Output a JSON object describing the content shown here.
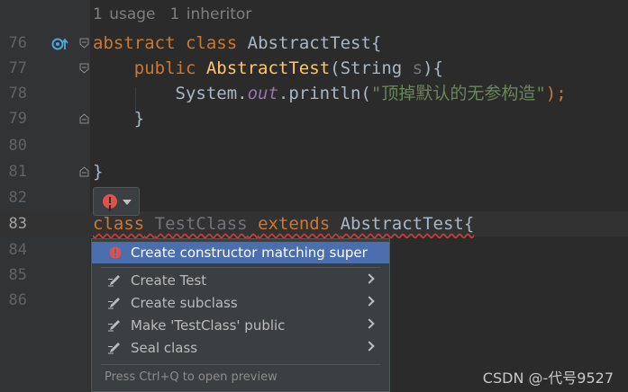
{
  "editor": {
    "hints": {
      "usages": "1 usage",
      "inheritors": "1 inheritor"
    },
    "lines": [
      {
        "number": "76",
        "tokens": [
          "abstract",
          "class",
          "AbstractTest{"
        ]
      },
      {
        "number": "77",
        "tokens": [
          "public",
          "AbstractTest",
          "(String ",
          "s",
          "){"
        ]
      },
      {
        "number": "78",
        "tokens": [
          "System.",
          "out",
          ".println(",
          "\"顶掉默认的无参构造\"",
          ");"
        ]
      },
      {
        "number": "79",
        "tokens": [
          "}"
        ]
      },
      {
        "number": "80",
        "tokens": []
      },
      {
        "number": "81",
        "tokens": [
          "}"
        ]
      },
      {
        "number": "82",
        "tokens": []
      },
      {
        "number": "83",
        "tokens": [
          "class",
          "TestClass",
          "extends",
          "AbstractTest{"
        ]
      },
      {
        "number": "84",
        "tokens": []
      },
      {
        "number": "85",
        "tokens": []
      },
      {
        "number": "86",
        "tokens": []
      }
    ],
    "current_line": "83",
    "gutter_icons": {
      "line_76": "implemented-marker-icon"
    }
  },
  "intention_bulb": {
    "icon": "error-bulb-icon",
    "dropdown_icon": "chevron-down-icon"
  },
  "intention_popup": {
    "selected_item": {
      "label": "Create constructor matching super",
      "icon": "error-bulb-icon"
    },
    "items": [
      {
        "label": "Create Test",
        "icon": "intention-pencil-icon",
        "has_submenu": true
      },
      {
        "label": "Create subclass",
        "icon": "intention-pencil-icon",
        "has_submenu": true
      },
      {
        "label": "Make 'TestClass' public",
        "icon": "intention-pencil-icon",
        "has_submenu": true
      },
      {
        "label": "Seal class",
        "icon": "intention-pencil-icon",
        "has_submenu": true
      }
    ],
    "footer": "Press Ctrl+Q to open preview"
  },
  "watermark": "CSDN @-代号9527",
  "colors": {
    "background": "#2b2b2b",
    "keyword": "#cc7832",
    "function": "#ffc66d",
    "string": "#6a8759",
    "field": "#9876aa",
    "selection": "#4b6eaf",
    "error": "#d9534f"
  }
}
